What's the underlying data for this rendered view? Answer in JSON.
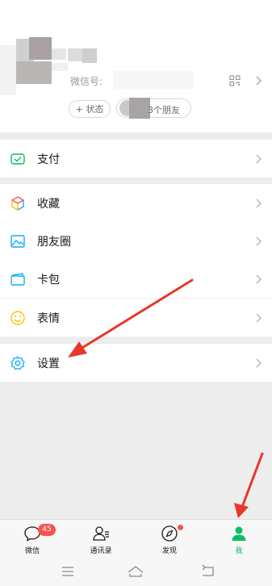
{
  "profile": {
    "wechat_id_label": "微信号:",
    "status_button": "+ 状态",
    "friends_text": "3个朋友"
  },
  "menu": {
    "pay": "支付",
    "favorites": "收藏",
    "moments": "朋友圈",
    "cards": "卡包",
    "stickers": "表情",
    "settings": "设置"
  },
  "tabbar": {
    "chats": "微信",
    "chats_badge": "45",
    "contacts": "通讯录",
    "discover": "发现",
    "me": "我",
    "active_color": "#07c160"
  },
  "colors": {
    "accent_green": "#07c160",
    "badge_red": "#fa5151",
    "annotation_red": "#e8372c"
  }
}
